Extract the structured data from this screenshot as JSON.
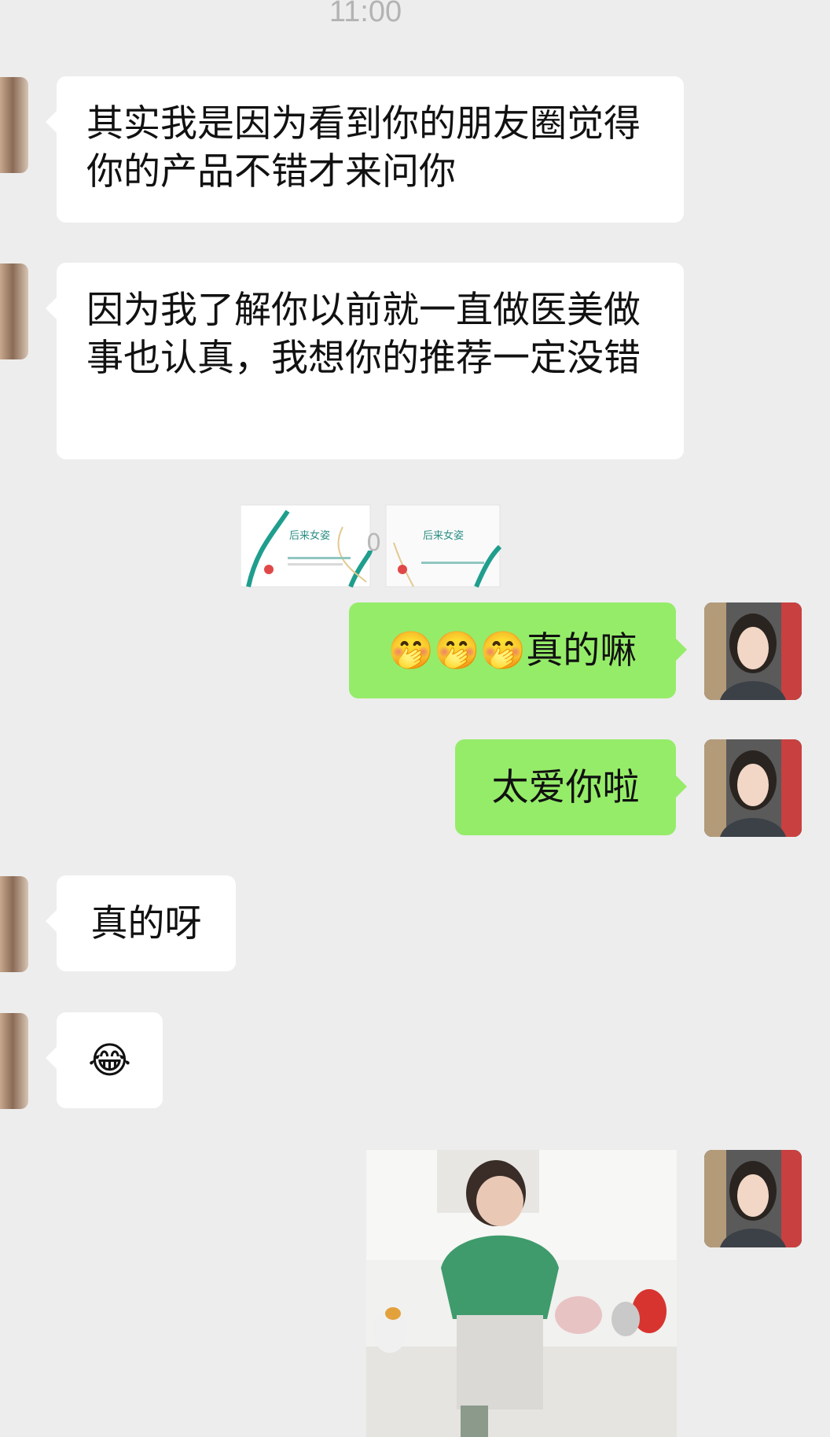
{
  "status": {
    "time": "11:00"
  },
  "messages": [
    {
      "text": "其实我是因为看到你的朋友圈觉得你的产品不错才来问你"
    },
    {
      "text": "因为我了解你以前就一直做医美做事也认真，我想你的推荐一定没错"
    },
    {
      "product_brand": "后来女姿",
      "product_overlay_text": "0"
    },
    {
      "text": "🤭🤭🤭真的嘛"
    },
    {
      "text": "太爱你啦"
    },
    {
      "text": "真的呀"
    },
    {
      "text": "😂"
    }
  ],
  "colors": {
    "background": "#ededed",
    "incoming_bubble": "#ffffff",
    "outgoing_bubble": "#95ec69"
  }
}
